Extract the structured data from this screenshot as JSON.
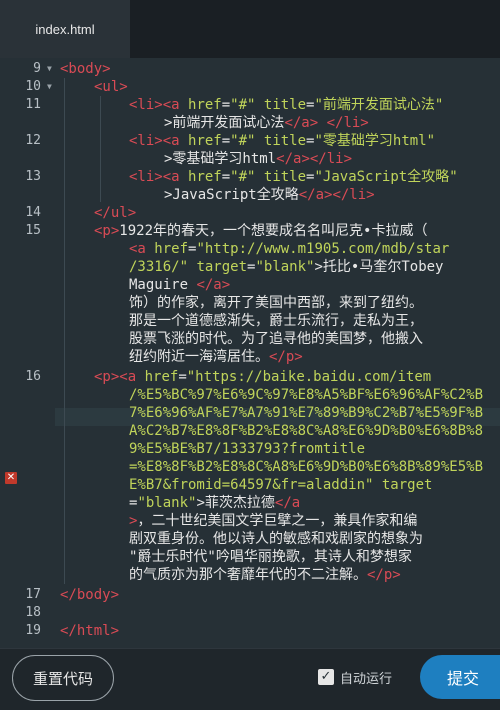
{
  "tab": {
    "title": "index.html"
  },
  "gutter": {
    "line_numbers": [
      "9",
      "10",
      "11",
      "12",
      "13",
      "14",
      "15",
      "16",
      "17",
      "18",
      "19"
    ]
  },
  "code": {
    "l9": [
      "<body>"
    ],
    "l10": [
      "<ul>"
    ],
    "l11a": [
      "<li>",
      "<a ",
      "href",
      "=",
      "\"#\"",
      " title",
      "=",
      "\"前端开发面试心法\""
    ],
    "l11b": [
      ">前端开发面试心法",
      "</a>",
      " ",
      "</li>"
    ],
    "l12a": [
      "<li>",
      "<a ",
      "href",
      "=",
      "\"#\"",
      " title",
      "=",
      "\"零基础学习html\""
    ],
    "l12b": [
      ">零基础学习html",
      "</a>",
      "</li>"
    ],
    "l13a": [
      "<li>",
      "<a ",
      "href",
      "=",
      "\"#\"",
      " title",
      "=",
      "\"JavaScript全攻略\""
    ],
    "l13b": [
      ">JavaScript全攻略",
      "</a>",
      "</li>"
    ],
    "l14": [
      "</ul>"
    ],
    "l15a": [
      "<p>",
      "1922年的春天，一个想要成名名叫尼克•卡拉威（"
    ],
    "l15b": [
      "<a ",
      "href",
      "=",
      "\"http://www.m1905.com/mdb/star"
    ],
    "l15c": [
      "/3316/\"",
      " target",
      "=",
      "\"blank\"",
      ">托比•马奎尔Tobey"
    ],
    "l15d": [
      "Maguire ",
      "</a>"
    ],
    "l15e": [
      "饰）的作家，离开了美国中西部，来到了纽约。"
    ],
    "l15f": [
      "那是一个道德感渐失，爵士乐流行，走私为王，"
    ],
    "l15g": [
      "股票飞涨的时代。为了追寻他的美国梦，他搬入"
    ],
    "l15h": [
      "纽约附近一海湾居住。",
      "</p>"
    ],
    "l16a": [
      "<p>",
      "<a ",
      "href",
      "=",
      "\"https://baike.baidu.com/item"
    ],
    "l16b": [
      "/%E5%BC%97%E6%9C%97%E8%A5%BF%E6%96%AF%C2%B"
    ],
    "l16c": [
      "7%E6%96%AF%E7%A7%91%E7%89%B9%C2%B7%E5%9F%B"
    ],
    "l16d": [
      "A%C2%B7%E8%8F%B2%E8%8C%A8%E6%9D%B0%E6%8B%8"
    ],
    "l16e": [
      "9%E5%BE%B7/1333793?fromtitle"
    ],
    "l16f": [
      "=%E8%8F%B2%E8%8C%A8%E6%9D%B0%E6%8B%89%E5%B"
    ],
    "l16g": [
      "E%B7&fromid=64597&fr=aladdin\"",
      " target"
    ],
    "l16h": [
      "=",
      "\"blank\"",
      ">菲茨杰拉德",
      "</a"
    ],
    "l16i": [
      ">",
      "，二十世纪美国文学巨擘之一，兼具作家和编"
    ],
    "l16j": [
      "剧双重身份。他以诗人的敏感和戏剧家的想象为"
    ],
    "l16k": [
      "\"爵士乐时代\"吟唱华丽挽歌，其诗人和梦想家"
    ],
    "l16l": [
      "的气质亦为那个奢靡年代的不二注解。",
      "</p>"
    ],
    "l17": [
      "</body>"
    ],
    "l19": [
      "</html>"
    ]
  },
  "footer": {
    "reset_label": "重置代码",
    "auto_run_label": "自动运行",
    "auto_run_checked": true,
    "submit_label": "提交"
  },
  "colors": {
    "tag": "#d94b55",
    "attr_value": "#c0d45a",
    "text": "#e6e6e6",
    "submit": "#1e7fc0"
  }
}
